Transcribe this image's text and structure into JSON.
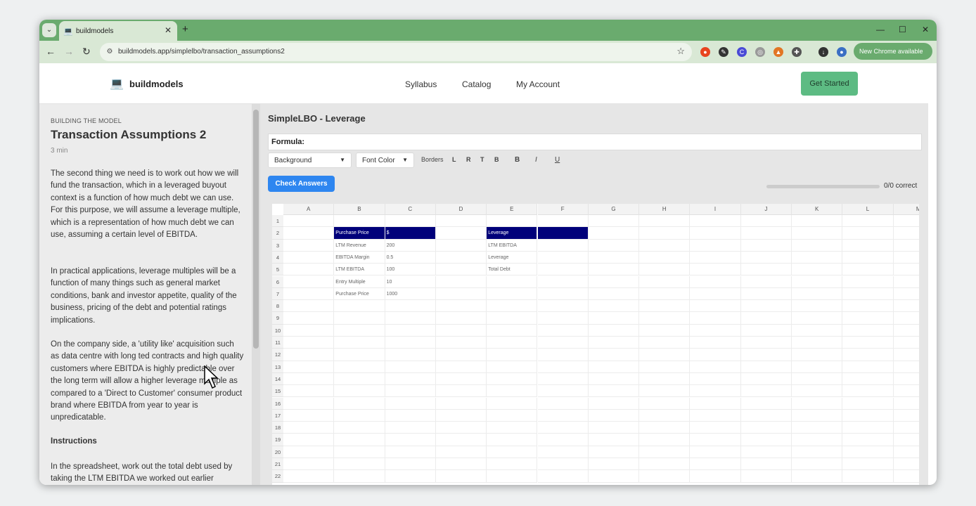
{
  "browser": {
    "tab_title": "buildmodels",
    "url": "buildmodels.app/simplelbo/transaction_assumptions2",
    "new_chrome_label": "New Chrome available"
  },
  "site": {
    "logo_text": "buildmodels",
    "nav": [
      "Syllabus",
      "Catalog",
      "My Account"
    ],
    "cta": "Get Started"
  },
  "lesson": {
    "eyebrow": "BUILDING THE MODEL",
    "title": "Transaction Assumptions 2",
    "duration": "3 min",
    "paragraphs": [
      "The second thing we need is to work out how we will fund the transaction, which in a leveraged buyout context is a function of how much debt we can use. For this purpose, we will assume a leverage multiple, which is a representation of how much debt we can use, assuming a certain level of EBITDA.",
      "In practical applications, leverage multiples will be a function of many things such as general market conditions, bank and investor appetite, quality of the business, pricing of the debt and potential ratings implications.",
      "On the company side, a 'utility like' acquisition such as data centre with long   ted contracts and high quality customers where EBITDA is highly predictable over the long term will allow a higher leverage multiple as compared to a 'Direct to Customer' consumer product brand where EBITDA from year to year is unpredicatable."
    ],
    "instructions_heading": "Instructions",
    "instructions_text": "In the spreadsheet, work out the total debt used by taking the LTM EBITDA we worked out earlier"
  },
  "workspace": {
    "title": "SimpleLBO - Leverage",
    "formula_label": "Formula:",
    "background_label": "Background",
    "font_color_label": "Font Color",
    "borders_label": "Borders",
    "border_buttons": [
      "L",
      "R",
      "T",
      "B"
    ],
    "bold": "B",
    "italic": "I",
    "underline": "U",
    "check_button": "Check Answers",
    "progress": 0,
    "score": "0/0 correct"
  },
  "sheet": {
    "columns": [
      "A",
      "B",
      "C",
      "D",
      "E",
      "F",
      "G",
      "H",
      "I",
      "J",
      "K",
      "L",
      "M"
    ],
    "rows": [
      "1",
      "2",
      "3",
      "4",
      "5",
      "6",
      "7",
      "8",
      "9",
      "10",
      "11",
      "12",
      "13",
      "14",
      "15",
      "16",
      "17",
      "18",
      "19",
      "20",
      "21",
      "22"
    ],
    "header_fill": "#00007a",
    "cells": {
      "B2": "Purchase Price",
      "C2": "$",
      "E2": "Leverage",
      "B3": "LTM Revenue",
      "C3": "200",
      "B4": "EBITDA Margin",
      "C4": "0.5",
      "B5": "LTM EBITDA",
      "C5": "100",
      "B6": "Entry Multiple",
      "C6": "10",
      "B7": "Purchase Price",
      "C7": "1000",
      "E3": "LTM EBITDA",
      "E4": "Leverage",
      "E5": "Total Debt"
    },
    "header_cells": [
      "B2",
      "C2",
      "E2",
      "F2"
    ]
  },
  "colors": {
    "accent_green": "#5dbb83",
    "button_blue": "#2e86f0",
    "chrome_green": "#6aab6e"
  }
}
